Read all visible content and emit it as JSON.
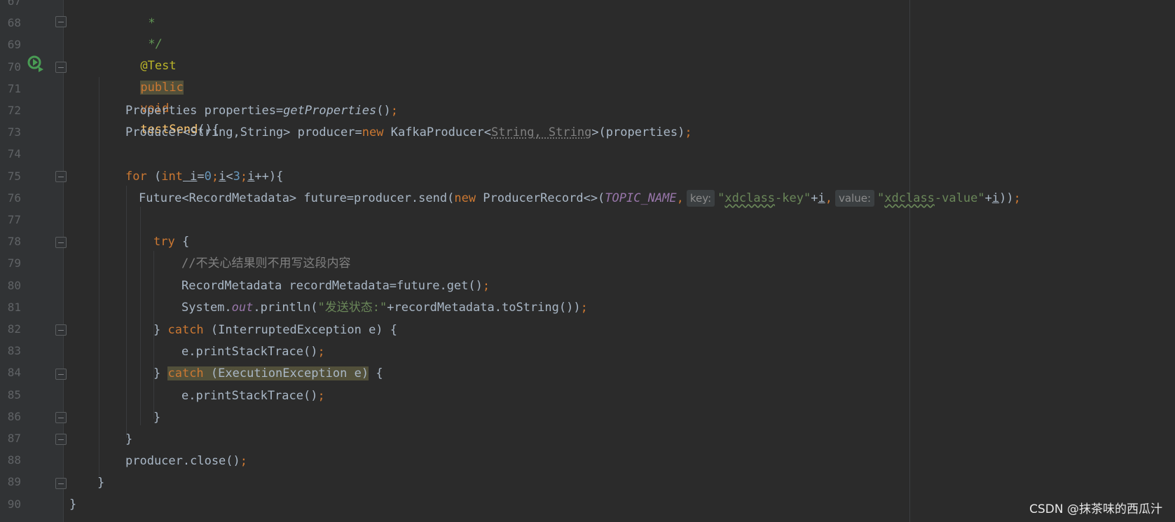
{
  "editor": {
    "language": "java",
    "line_numbers": [
      "67",
      "68",
      "69",
      "70",
      "71",
      "72",
      "73",
      "74",
      "75",
      "76",
      "77",
      "78",
      "79",
      "80",
      "81",
      "82",
      "83",
      "84",
      "85",
      "86",
      "87",
      "88",
      "89",
      "90"
    ],
    "code": {
      "l67": "*",
      "l68": "*/",
      "l69_annotation": "@Test",
      "l70_public": "public",
      "l70_void": "void",
      "l70_name": "testSend",
      "l70_rest": "(){",
      "l72_type": "Properties properties=",
      "l72_call": "getProperties",
      "l72_end": "()",
      "l72_semi": ";",
      "l73_a": "Producer<String,String> producer=",
      "l73_new": "new",
      "l73_class": " KafkaProducer<",
      "l73_generic": "String, String",
      "l73_rest": ">(properties)",
      "l73_semi": ";",
      "l75_for": "for",
      "l75_open": " (",
      "l75_int": "int",
      "l75_i1": " i",
      "l75_eq": "=",
      "l75_zero": "0",
      "l75_semi1": ";",
      "l75_i2": "i",
      "l75_lt": "<",
      "l75_three": "3",
      "l75_semi2": ";",
      "l75_i3": "i",
      "l75_rest": "++){",
      "l76_a": "Future<RecordMetadata> future=producer.send(",
      "l76_new": "new",
      "l76_class": " ProducerRecord<>(",
      "l76_topic": "TOPIC_NAME",
      "l76_comma1": ",",
      "l76_hint_key": "key:",
      "l76_q1": "\"",
      "l76_key_w": "xdclass",
      "l76_key_rest": "-key\"",
      "l76_plus1": "+",
      "l76_i1": "i",
      "l76_comma2": ",",
      "l76_hint_value": "value:",
      "l76_q2": "\"",
      "l76_val_w": "xdclass",
      "l76_val_rest": "-value\"",
      "l76_plus2": "+",
      "l76_i2": "i",
      "l76_end": "))",
      "l76_semi": ";",
      "l78_try": "try",
      "l78_rest": " {",
      "l79_comment": "//不关心结果则不用写这段内容",
      "l80_a": "RecordMetadata recordMetadata=future.get()",
      "l80_semi": ";",
      "l81_a": "System.",
      "l81_out": "out",
      "l81_b": ".println(",
      "l81_str": "\"发送状态:\"",
      "l81_c": "+recordMetadata.toString())",
      "l81_semi": ";",
      "l82_brace": "} ",
      "l82_catch": "catch",
      "l82_rest": " (InterruptedException e) {",
      "l83_a": "e.printStackTrace()",
      "l83_semi": ";",
      "l84_brace": "} ",
      "l84_catch": "catch",
      "l84_hl": " (ExecutionException e)",
      "l84_rest": " {",
      "l85_a": "e.printStackTrace()",
      "l85_semi": ";",
      "l86": "}",
      "l87": "}",
      "l88_a": "producer.close()",
      "l88_semi": ";",
      "l89": "}",
      "l90": "}"
    },
    "icons": {
      "run": "run-test-gutter-icon",
      "fold": "fold-marker-icon"
    },
    "colors": {
      "background": "#2b2b2b",
      "keyword": "#cc7832",
      "string": "#6a8759",
      "function": "#ffc66d",
      "annotation": "#bbb529",
      "number": "#6897bb",
      "comment": "#808080",
      "run_icon": "#499c54"
    }
  },
  "watermark": "CSDN @抹茶味的西瓜汁"
}
